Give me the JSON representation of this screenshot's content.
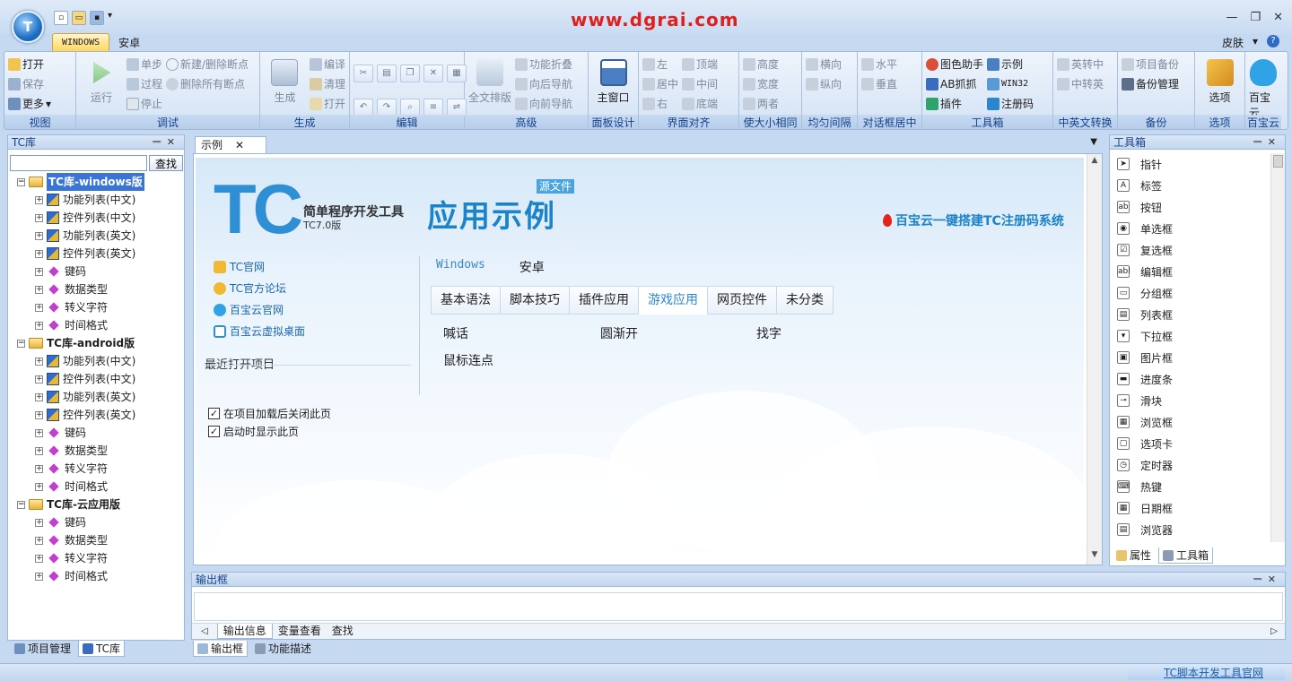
{
  "app": {
    "orb_label": "T",
    "watermark": "www.dgrai.com"
  },
  "window_controls": {
    "minimize": "—",
    "restore": "❐",
    "close": "✕"
  },
  "ribbon_tabs": [
    "WINDOWS",
    "安卓"
  ],
  "skin_menu": {
    "label": "皮肤",
    "help": "?"
  },
  "ribbon": {
    "view": {
      "label": "视图",
      "open": "打开",
      "save": "保存",
      "more": "更多"
    },
    "debug": {
      "label": "调试",
      "run": "运行",
      "step": "单步",
      "procedure": "过程",
      "stop": "停止",
      "new_delete_breakpoint": "新建/删除断点",
      "delete_all_breakpoints": "删除所有断点"
    },
    "build": {
      "label": "生成",
      "build": "生成",
      "compile": "编译",
      "clean": "清理",
      "open": "打开"
    },
    "edit": {
      "label": "编辑"
    },
    "advanced": {
      "label": "高级",
      "full_format": "全文排版",
      "fold": "功能折叠",
      "nav_back": "向后导航",
      "nav_forward": "向前导航"
    },
    "panel_design": {
      "label": "面板设计",
      "main_window": "主窗口"
    },
    "align": {
      "label": "界面对齐",
      "left": "左",
      "center": "居中",
      "right": "右",
      "top": "顶端",
      "middle": "中间",
      "bottom": "底端"
    },
    "same_size": {
      "label": "使大小相同",
      "height": "高度",
      "width": "宽度",
      "both": "两者"
    },
    "spacing": {
      "label": "均匀间隔",
      "horizontal": "横向",
      "vertical": "纵向"
    },
    "dialog_center": {
      "label": "对话框居中",
      "horizontal": "水平",
      "vertical": "垂直"
    },
    "toolbox": {
      "label": "工具箱",
      "color_helper": "图色助手",
      "ab_grab": "AB抓抓",
      "plugin": "插件",
      "example": "示例",
      "win32": "WIN32",
      "reg_code": "注册码"
    },
    "lang_convert": {
      "label": "中英文转换",
      "en_to_cn": "英转中",
      "cn_to_en": "中转英"
    },
    "backup": {
      "label": "备份",
      "project_backup": "项目备份",
      "backup_manage": "备份管理"
    },
    "options": {
      "label": "选项",
      "options": "选项"
    },
    "cloud": {
      "label": "百宝云",
      "name": "百宝云"
    }
  },
  "left_panel": {
    "title": "TC库",
    "search_button": "查找",
    "search_value": "",
    "tree": [
      {
        "label": "TC库-windows版",
        "selected": true,
        "children": [
          {
            "label": "功能列表(中文)",
            "icon": "grid"
          },
          {
            "label": "控件列表(中文)",
            "icon": "grid"
          },
          {
            "label": "功能列表(英文)",
            "icon": "grid"
          },
          {
            "label": "控件列表(英文)",
            "icon": "grid"
          },
          {
            "label": "键码",
            "icon": "diamond"
          },
          {
            "label": "数据类型",
            "icon": "diamond"
          },
          {
            "label": "转义字符",
            "icon": "diamond"
          },
          {
            "label": "时间格式",
            "icon": "diamond"
          }
        ]
      },
      {
        "label": "TC库-android版",
        "selected": false,
        "children": [
          {
            "label": "功能列表(中文)",
            "icon": "grid"
          },
          {
            "label": "控件列表(中文)",
            "icon": "grid"
          },
          {
            "label": "功能列表(英文)",
            "icon": "grid"
          },
          {
            "label": "控件列表(英文)",
            "icon": "grid"
          },
          {
            "label": "键码",
            "icon": "diamond"
          },
          {
            "label": "数据类型",
            "icon": "diamond"
          },
          {
            "label": "转义字符",
            "icon": "diamond"
          },
          {
            "label": "时间格式",
            "icon": "diamond"
          }
        ]
      },
      {
        "label": "TC库-云应用版",
        "selected": false,
        "children": [
          {
            "label": "键码",
            "icon": "diamond"
          },
          {
            "label": "数据类型",
            "icon": "diamond"
          },
          {
            "label": "转义字符",
            "icon": "diamond"
          },
          {
            "label": "时间格式",
            "icon": "diamond"
          }
        ]
      }
    ],
    "bottom_tabs": [
      "项目管理",
      "TC库"
    ]
  },
  "doc": {
    "tab_label": "示例",
    "logo": "TC",
    "logo_subtitle": "简单程序开发工具",
    "logo_version": "TC7.0版",
    "app_title": "应用示例",
    "source_badge": "源文件",
    "promo": "百宝云一键搭建TC注册码系统",
    "links": [
      "TC官网",
      "TC官方论坛",
      "百宝云官网",
      "百宝云虚拟桌面"
    ],
    "recent_title": "最近打开项目",
    "checks": [
      {
        "label": "在项目加载后关闭此页",
        "checked": true
      },
      {
        "label": "启动时显示此页",
        "checked": true
      }
    ],
    "platforms": [
      "Windows",
      "安卓"
    ],
    "category_tabs": [
      "基本语法",
      "脚本技巧",
      "插件应用",
      "游戏应用",
      "网页控件",
      "未分类"
    ],
    "active_category": "游戏应用",
    "items": [
      "喊话",
      "圆渐开",
      "找字",
      "鼠标连点"
    ]
  },
  "toolbox": {
    "title": "工具箱",
    "tools": [
      "指针",
      "标签",
      "按钮",
      "单选框",
      "复选框",
      "编辑框",
      "分组框",
      "列表框",
      "下拉框",
      "图片框",
      "进度条",
      "滑块",
      "浏览框",
      "选项卡",
      "定时器",
      "热键",
      "日期框",
      "浏览器"
    ],
    "bottom_tabs": [
      "属性",
      "工具箱"
    ]
  },
  "output": {
    "title": "输出框",
    "tabs": [
      "输出信息",
      "变量查看",
      "查找"
    ],
    "bottom_tabs": [
      "输出框",
      "功能描述"
    ]
  },
  "status": {
    "link": "TC脚本开发工具官网"
  },
  "colors": {
    "accent": "#1b83c9",
    "ribbon_label": "#15428b",
    "promo_flame": "#e3241b",
    "watermark": "#e0201e"
  }
}
